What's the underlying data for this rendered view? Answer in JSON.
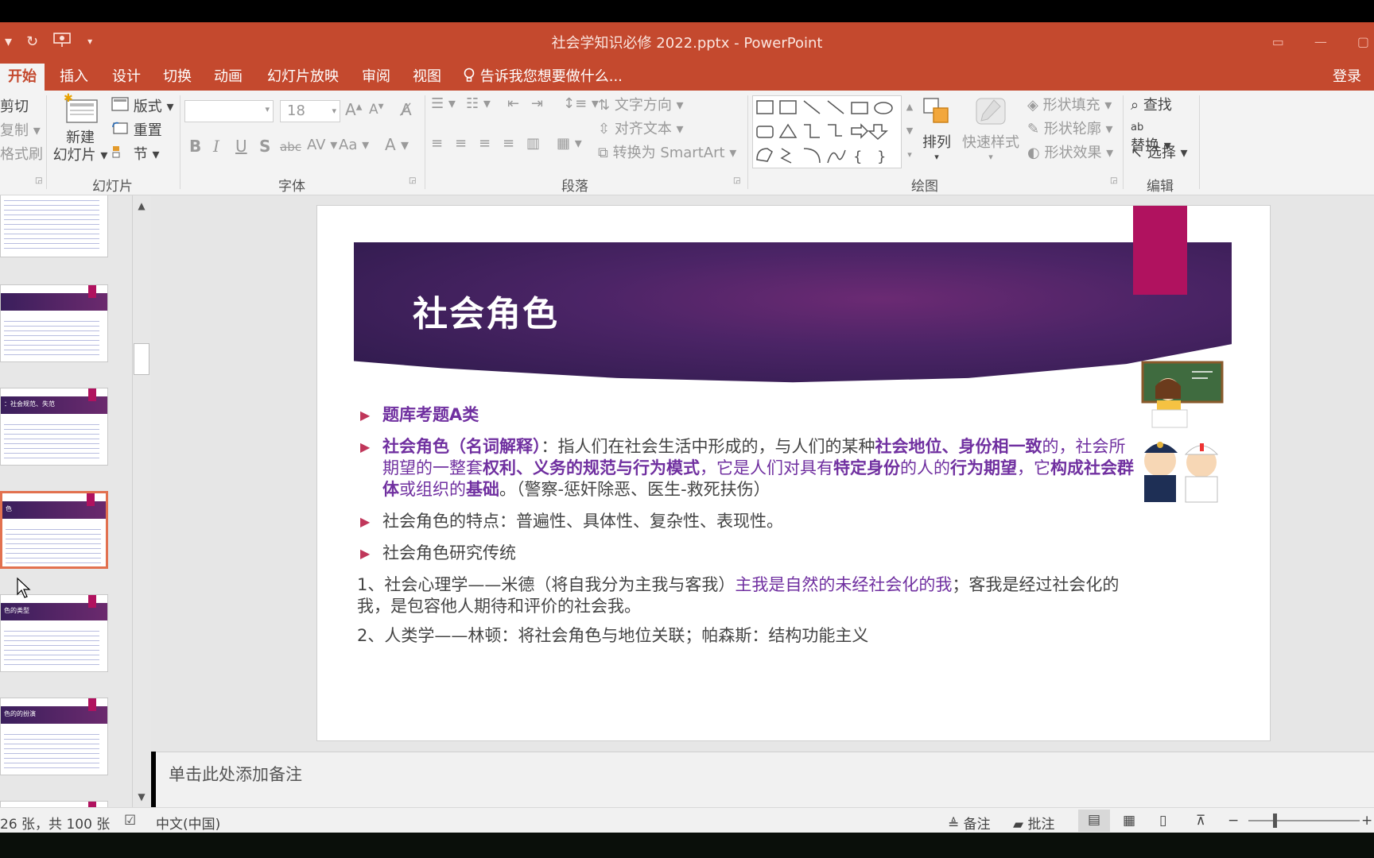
{
  "window": {
    "title": "社会学知识必修 2022.pptx - PowerPoint"
  },
  "tabs": [
    {
      "label": "开始",
      "active": true
    },
    {
      "label": "插入"
    },
    {
      "label": "设计"
    },
    {
      "label": "切换"
    },
    {
      "label": "动画"
    },
    {
      "label": "幻灯片放映"
    },
    {
      "label": "审阅"
    },
    {
      "label": "视图"
    }
  ],
  "tell_me": "告诉我您想要做什么...",
  "login": "登录",
  "ribbon": {
    "clipboard": {
      "cut": "剪切",
      "copy": "复制",
      "format_painter": "格式刷"
    },
    "slides": {
      "new_slide_line1": "新建",
      "new_slide_line2": "幻灯片",
      "layout": "版式",
      "reset": "重置",
      "section": "节",
      "group_label": "幻灯片"
    },
    "font": {
      "font_name": "",
      "font_size": "18",
      "group_label": "字体"
    },
    "paragraph": {
      "text_direction": "文字方向",
      "align_text": "对齐文本",
      "convert_smartart": "转换为 SmartArt",
      "group_label": "段落"
    },
    "drawing": {
      "arrange": "排列",
      "quick_styles": "快速样式",
      "shape_fill": "形状填充",
      "shape_outline": "形状轮廓",
      "shape_effects": "形状效果",
      "group_label": "绘图"
    },
    "editing": {
      "find": "查找",
      "replace": "替换",
      "select": "选择",
      "group_label": "编辑"
    }
  },
  "thumbnails": {
    "items": [
      {
        "title": ""
      },
      {
        "title": ""
      },
      {
        "title": "：社会规范、失范"
      },
      {
        "title": "色",
        "selected": true
      },
      {
        "title": "色的类型"
      },
      {
        "title": "色的的扮演"
      }
    ]
  },
  "slide": {
    "title": "社会角色",
    "bullet1": "题库考题A类",
    "b2_term": "社会角色（名词解释）",
    "b2_t1": "：指人们在社会生活中形成的，与人们的某种",
    "b2_bold1": "社会地位、身份相一致",
    "b2_t2": "的，社会所期望的一整套",
    "b2_bold2": "权利、义务的规范与行为模式",
    "b2_t3": "，它是人们对具有",
    "b2_bold3": "特定身份",
    "b2_t4": "的人的",
    "b2_bold4": "行为期望",
    "b2_t5": "，它",
    "b2_bold5": "构成社会群体",
    "b2_t6": "或组织的",
    "b2_bold6": "基础",
    "b2_t7": "。（警察-惩奸除恶、医生-救死扶伤）",
    "bullet3": "社会角色的特点：普遍性、具体性、复杂性、表现性。",
    "bullet4": "社会角色研究传统",
    "p1_a": "1、社会心理学——米德（将自我分为主我与客我）",
    "p1_b": "主我是自然的未经社会化的我",
    "p1_c": "；客我是经过社会化的我，是包容他人期待和评价的社会我。",
    "p2": "2、人类学——林顿：将社会角色与地位关联；帕森斯：结构功能主义"
  },
  "notes": {
    "placeholder": "单击此处添加备注"
  },
  "status": {
    "slide_count": "26 张，共 100 张",
    "language": "中文(中国)",
    "notes_btn": "备注",
    "comments_btn": "批注"
  },
  "colors": {
    "accent": "#c4492e",
    "slide_purple": "#7030a0",
    "slide_magenta": "#b0125f"
  }
}
